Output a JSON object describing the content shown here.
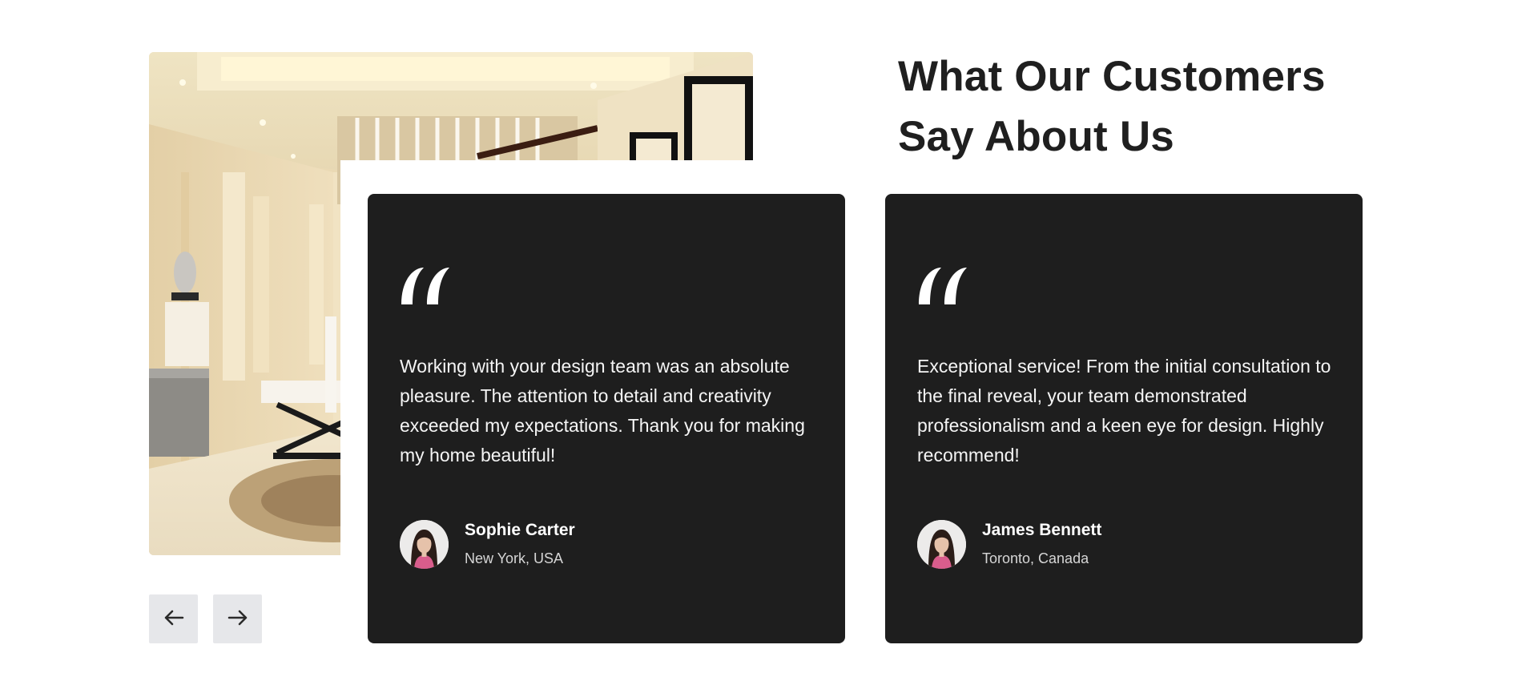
{
  "section": {
    "heading": "What Our Customers Say About Us"
  },
  "photo": {
    "alt": "Modern interior hallway with staircase and framed pictures",
    "icon": "interior-photo"
  },
  "testimonials": [
    {
      "quote": "Working with your design team was an absolute pleasure. The attention to detail and creativity exceeded my expectations. Thank you for making my home beautiful!",
      "name": "Sophie Carter",
      "location": "New York, USA",
      "avatar_icon": "avatar-photo"
    },
    {
      "quote": "Exceptional service! From the initial consultation to the final reveal, your team demonstrated professionalism and a keen eye for design. Highly recommend!",
      "name": "James Bennett",
      "location": "Toronto, Canada",
      "avatar_icon": "avatar-photo"
    }
  ],
  "navigation": {
    "prev_icon": "arrow-left-icon",
    "next_icon": "arrow-right-icon"
  },
  "colors": {
    "card_background": "#1e1e1e",
    "heading_text": "#1f1f1f",
    "nav_button_background": "#e6e7ea"
  }
}
